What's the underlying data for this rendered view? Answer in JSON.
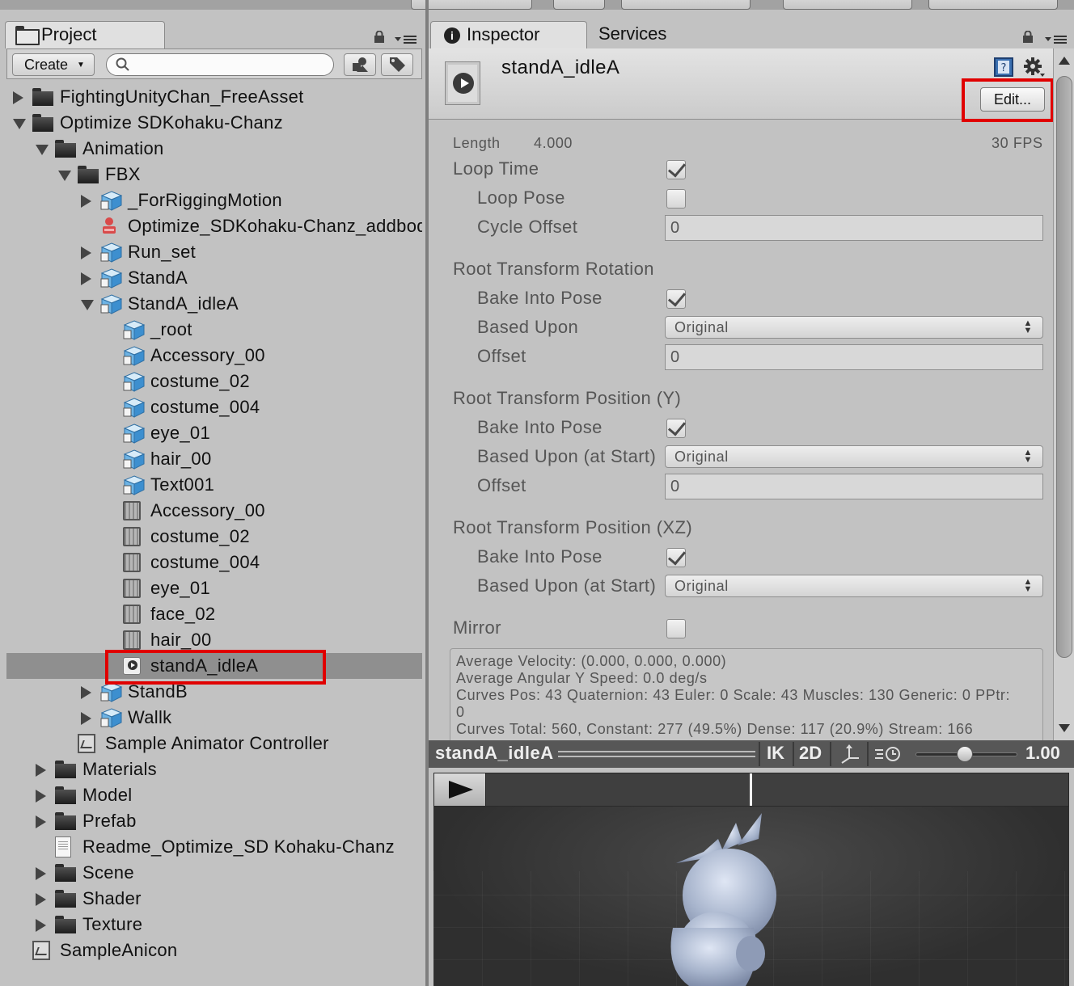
{
  "project": {
    "tab_label": "Project",
    "create_label": "Create",
    "search_placeholder": "",
    "tree": [
      {
        "label": "FightingUnityChan_FreeAsset",
        "depth": 0,
        "arrow": "right",
        "icon": "folder"
      },
      {
        "label": "Optimize SDKohaku-Chanz",
        "depth": 0,
        "arrow": "down",
        "icon": "folder"
      },
      {
        "label": "Animation",
        "depth": 1,
        "arrow": "down",
        "icon": "folder"
      },
      {
        "label": "FBX",
        "depth": 2,
        "arrow": "down",
        "icon": "folder"
      },
      {
        "label": "_ForRiggingMotion",
        "depth": 3,
        "arrow": "right",
        "icon": "model-prefab"
      },
      {
        "label": "Optimize_SDKohaku-Chanz_addbody",
        "depth": 3,
        "arrow": "none",
        "icon": "rig"
      },
      {
        "label": "Run_set",
        "depth": 3,
        "arrow": "right",
        "icon": "model-prefab"
      },
      {
        "label": "StandA",
        "depth": 3,
        "arrow": "right",
        "icon": "model-prefab"
      },
      {
        "label": "StandA_idleA",
        "depth": 3,
        "arrow": "down",
        "icon": "model-prefab"
      },
      {
        "label": "_root",
        "depth": 4,
        "arrow": "none",
        "icon": "model-prefab"
      },
      {
        "label": "Accessory_00",
        "depth": 4,
        "arrow": "none",
        "icon": "model-prefab"
      },
      {
        "label": "costume_02",
        "depth": 4,
        "arrow": "none",
        "icon": "model-prefab"
      },
      {
        "label": "costume_004",
        "depth": 4,
        "arrow": "none",
        "icon": "model-prefab"
      },
      {
        "label": "eye_01",
        "depth": 4,
        "arrow": "none",
        "icon": "model-prefab"
      },
      {
        "label": "hair_00",
        "depth": 4,
        "arrow": "none",
        "icon": "model-prefab"
      },
      {
        "label": "Text001",
        "depth": 4,
        "arrow": "none",
        "icon": "model-prefab"
      },
      {
        "label": "Accessory_00",
        "depth": 4,
        "arrow": "none",
        "icon": "mesh"
      },
      {
        "label": "costume_02",
        "depth": 4,
        "arrow": "none",
        "icon": "mesh"
      },
      {
        "label": "costume_004",
        "depth": 4,
        "arrow": "none",
        "icon": "mesh"
      },
      {
        "label": "eye_01",
        "depth": 4,
        "arrow": "none",
        "icon": "mesh"
      },
      {
        "label": "face_02",
        "depth": 4,
        "arrow": "none",
        "icon": "mesh"
      },
      {
        "label": "hair_00",
        "depth": 4,
        "arrow": "none",
        "icon": "mesh"
      },
      {
        "label": "standA_idleA",
        "depth": 4,
        "arrow": "none",
        "icon": "animation-clip",
        "selected": true
      },
      {
        "label": "StandB",
        "depth": 3,
        "arrow": "right",
        "icon": "model-prefab"
      },
      {
        "label": "Wallk",
        "depth": 3,
        "arrow": "right",
        "icon": "model-prefab"
      },
      {
        "label": "Sample Animator Controller",
        "depth": 2,
        "arrow": "none",
        "icon": "animator"
      },
      {
        "label": "Materials",
        "depth": 1,
        "arrow": "right",
        "icon": "folder"
      },
      {
        "label": "Model",
        "depth": 1,
        "arrow": "right",
        "icon": "folder"
      },
      {
        "label": "Prefab",
        "depth": 1,
        "arrow": "right",
        "icon": "folder"
      },
      {
        "label": "Readme_Optimize_SD Kohaku-Chanz",
        "depth": 1,
        "arrow": "none",
        "icon": "document"
      },
      {
        "label": "Scene",
        "depth": 1,
        "arrow": "right",
        "icon": "folder"
      },
      {
        "label": "Shader",
        "depth": 1,
        "arrow": "right",
        "icon": "folder"
      },
      {
        "label": "Texture",
        "depth": 1,
        "arrow": "right",
        "icon": "folder"
      },
      {
        "label": "SampleAnicon",
        "depth": 0,
        "arrow": "none",
        "icon": "animator"
      }
    ]
  },
  "inspector": {
    "tab_label": "Inspector",
    "services_tab": "Services",
    "clip_name": "standA_idleA",
    "edit_label": "Edit...",
    "length_label": "Length",
    "length_value": "4.000",
    "fps": "30 FPS",
    "loop_time": {
      "label": "Loop Time",
      "checked": true
    },
    "loop_pose": {
      "label": "Loop Pose",
      "checked": false
    },
    "cycle_offset": {
      "label": "Cycle Offset",
      "value": "0"
    },
    "rotation": {
      "title": "Root Transform Rotation",
      "bake_label": "Bake Into Pose",
      "bake": true,
      "based_label": "Based Upon",
      "based_value": "Original",
      "offset_label": "Offset",
      "offset_value": "0"
    },
    "position_y": {
      "title": "Root Transform Position (Y)",
      "bake_label": "Bake Into Pose",
      "bake": true,
      "based_label": "Based Upon (at Start)",
      "based_value": "Original",
      "offset_label": "Offset",
      "offset_value": "0"
    },
    "position_xz": {
      "title": "Root Transform Position (XZ)",
      "bake_label": "Bake Into Pose",
      "bake": true,
      "based_label": "Based Upon (at Start)",
      "based_value": "Original"
    },
    "mirror": {
      "label": "Mirror",
      "checked": false
    },
    "info_lines": [
      "Average Velocity: (0.000, 0.000, 0.000)",
      "Average Angular Y Speed: 0.0 deg/s",
      "Curves Pos: 43 Quaternion: 43 Euler: 0 Scale: 43 Muscles: 130 Generic: 0 PPtr:",
      "0",
      "Curves Total: 560, Constant: 277 (49.5%) Dense: 117 (20.9%) Stream: 166"
    ]
  },
  "preview": {
    "clip_name": "standA_idleA",
    "ik_label": "IK",
    "twod_label": "2D",
    "speed": "1.00",
    "playhead_fraction": 0.45,
    "speed_slider_fraction": 0.48
  },
  "colors": {
    "highlight": "#e00000",
    "selection": "#8f8f8f"
  }
}
